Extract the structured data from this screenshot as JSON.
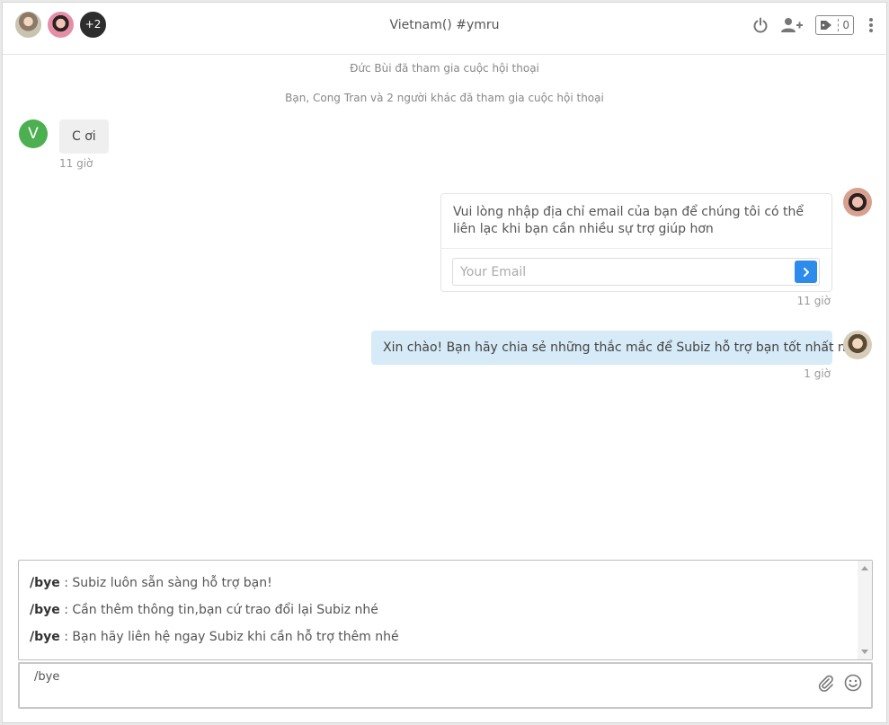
{
  "header": {
    "title": "Vietnam() #ymru",
    "participants_more": "+2",
    "tag_count": "0"
  },
  "system_messages": [
    "Đức Bùi đã tham gia cuộc hội thoại",
    "Bạn, Cong Tran và 2 người khác đã tham gia cuộc hội thoại"
  ],
  "messages": {
    "visitor": {
      "avatar_initial": "V",
      "text": "C ơi",
      "time": "11 giờ"
    },
    "email_request": {
      "text": "Vui lòng nhập địa chỉ email của bạn để chúng tôi có thể liên lạc khi bạn cần nhiều sự trợ giúp hơn",
      "placeholder": "Your Email",
      "time": "11 giờ"
    },
    "agent": {
      "text": "Xin chào! Bạn hãy chia sẻ những thắc mắc để Subiz hỗ trợ bạn tốt nhất nhé",
      "time": "1 giờ"
    }
  },
  "suggestions": [
    {
      "command": "/bye",
      "text": " : Subiz luôn sẵn sàng hỗ trợ bạn!"
    },
    {
      "command": "/bye",
      "text": " : Cần thêm thông tin,bạn cứ trao đổi lại Subiz nhé"
    },
    {
      "command": "/bye",
      "text": " : Bạn hãy liên hệ ngay Subiz khi cần hỗ trợ thêm nhé"
    }
  ],
  "composer": {
    "value": "/bye"
  },
  "colors": {
    "accent": "#2d8ceb",
    "visitor_avatar": "#4caf50",
    "agent_bubble": "#d6eaf8",
    "visitor_bubble": "#efefef"
  },
  "icons": [
    "power-icon",
    "add-user-icon",
    "tag-icon",
    "more-vertical-icon",
    "chevron-right-icon",
    "paperclip-icon",
    "smiley-icon"
  ]
}
